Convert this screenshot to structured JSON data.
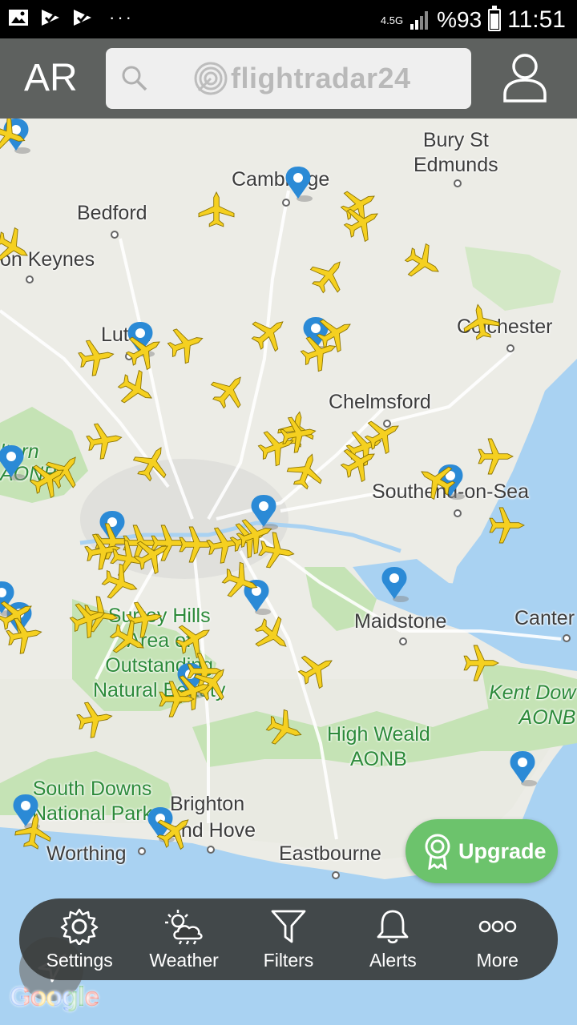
{
  "status_bar": {
    "network": "4.5G",
    "battery": "%93",
    "time": "11:51"
  },
  "top_bar": {
    "ar_label": "AR",
    "logo_text": "flightradar24"
  },
  "map": {
    "places": [
      {
        "id": "cambridge",
        "label": "Cambridge"
      },
      {
        "id": "bury",
        "label": "Bury St\nEdmunds"
      },
      {
        "id": "bedford",
        "label": "Bedford"
      },
      {
        "id": "keynes",
        "label": "on Keynes"
      },
      {
        "id": "luton",
        "label": "Luton"
      },
      {
        "id": "colchester",
        "label": "Colchester"
      },
      {
        "id": "chelmsford",
        "label": "Chelmsford"
      },
      {
        "id": "southend",
        "label": "Southend-on-Sea"
      },
      {
        "id": "maidstone",
        "label": "Maidstone"
      },
      {
        "id": "canterbury",
        "label": "Canter"
      },
      {
        "id": "surrey",
        "label": "Surrey Hills\nArea of\nOutstanding\nNatural Beauty"
      },
      {
        "id": "kent",
        "label": "Kent Dow\nAONB"
      },
      {
        "id": "weald",
        "label": "High Weald\nAONB"
      },
      {
        "id": "southdowns",
        "label": "South Downs\nNational Park"
      },
      {
        "id": "brighton",
        "label": "Brighton\nand Hove"
      },
      {
        "id": "worthing",
        "label": "Worthing"
      },
      {
        "id": "eastbourne",
        "label": "Eastbourne"
      },
      {
        "id": "chilterns",
        "label": "ltern\nAONB"
      }
    ]
  },
  "upgrade_button": {
    "label": "Upgrade"
  },
  "bottom_nav": {
    "items": [
      {
        "label": "Settings",
        "icon": "gear-icon"
      },
      {
        "label": "Weather",
        "icon": "weather-icon"
      },
      {
        "label": "Filters",
        "icon": "filter-icon"
      },
      {
        "label": "Alerts",
        "icon": "bell-icon"
      },
      {
        "label": "More",
        "icon": "more-icon"
      }
    ]
  },
  "google_logo": "Google",
  "colors": {
    "plane": "#f5d020",
    "pin": "#2b8ad6",
    "upgrade": "#6cc36c",
    "water": "#a9d2f2",
    "park": "#c5e3b5"
  }
}
